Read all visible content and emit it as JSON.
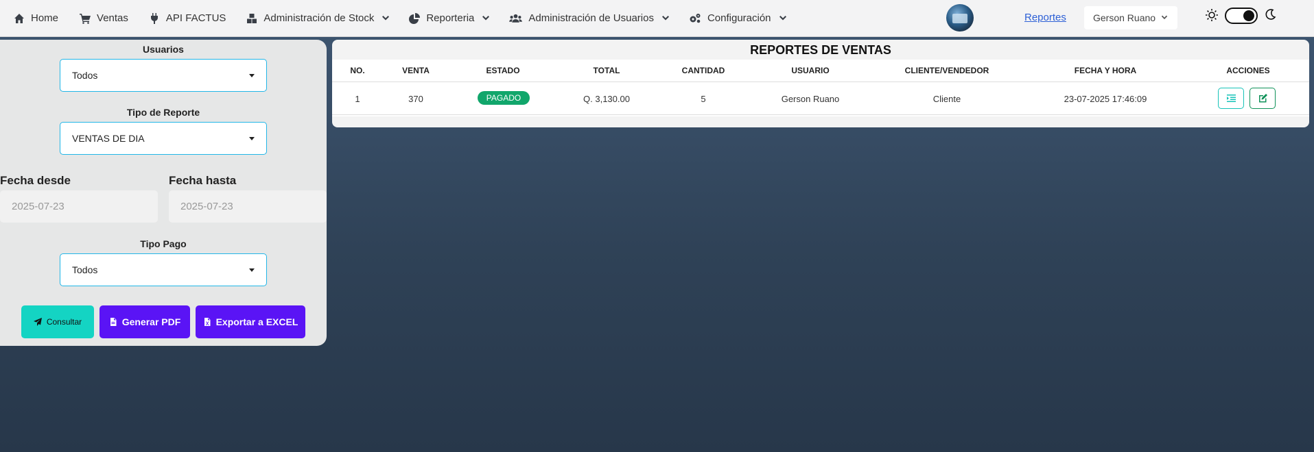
{
  "navbar": {
    "items": [
      {
        "label": "Home",
        "icon": "home-icon"
      },
      {
        "label": "Ventas",
        "icon": "cart-icon"
      },
      {
        "label": "API FACTUS",
        "icon": "plug-icon"
      },
      {
        "label": "Administración de Stock",
        "icon": "boxes-icon"
      },
      {
        "label": "Reporteria",
        "icon": "pie-chart-icon"
      },
      {
        "label": "Administración de Usuarios",
        "icon": "users-icon"
      },
      {
        "label": "Configuración",
        "icon": "gears-icon"
      }
    ],
    "reportes_link": "Reportes",
    "user_name": "Gerson Ruano"
  },
  "filters": {
    "usuarios_label": "Usuarios",
    "usuarios_value": "Todos",
    "tipo_reporte_label": "Tipo de Reporte",
    "tipo_reporte_value": "VENTAS DE DIA",
    "fecha_desde_label": "Fecha desde",
    "fecha_desde_value": "2025-07-23",
    "fecha_hasta_label": "Fecha hasta",
    "fecha_hasta_value": "2025-07-23",
    "tipo_pago_label": "Tipo Pago",
    "tipo_pago_value": "Todos"
  },
  "buttons": {
    "consultar": "Consultar",
    "generar_pdf": "Generar PDF",
    "exportar_excel": "Exportar a EXCEL"
  },
  "report": {
    "title": "REPORTES DE VENTAS",
    "columns": [
      "NO.",
      "VENTA",
      "ESTADO",
      "TOTAL",
      "CANTIDAD",
      "USUARIO",
      "CLIENTE/VENDEDOR",
      "FECHA Y HORA",
      "ACCIONES"
    ],
    "rows": [
      {
        "no": "1",
        "venta": "370",
        "estado": "PAGADO",
        "total": "Q. 3,130.00",
        "cantidad": "5",
        "usuario": "Gerson Ruano",
        "cliente_vendedor": "Cliente",
        "fecha_hora": "23-07-2025 17:46:09"
      }
    ]
  },
  "colors": {
    "accent_teal": "#14d4c3",
    "accent_purple": "#5a14f5",
    "status_paid": "#11a66b",
    "select_border": "#21b6e8"
  }
}
